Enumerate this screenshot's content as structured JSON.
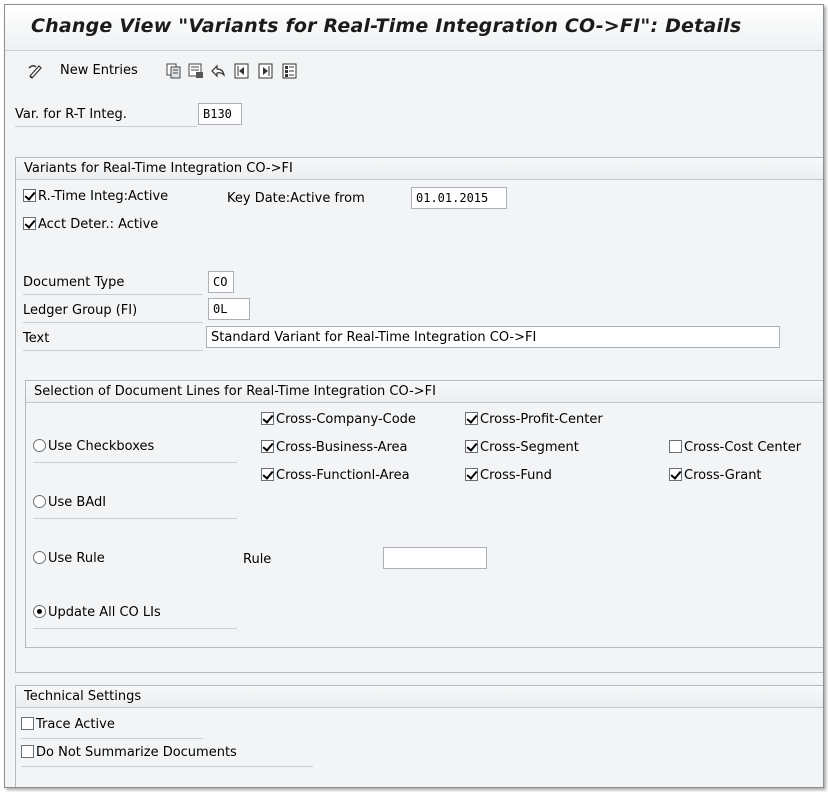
{
  "window": {
    "title": "Change View \"Variants for Real-Time Integration CO->FI\": Details"
  },
  "toolbar": {
    "new_entries_label": "New Entries",
    "icons": [
      "display-change-icon",
      "copy-icon",
      "delete-icon",
      "undo-icon",
      "previous-entry-icon",
      "next-entry-icon",
      "select-all-icon"
    ]
  },
  "variant": {
    "label": "Var. for R-T Integ.",
    "value": "B130"
  },
  "variants_group": {
    "title": "Variants for Real-Time Integration CO->FI",
    "rt_active_label": "R.-Time Integ:Active",
    "rt_active_checked": true,
    "key_date_label": "Key Date:Active from",
    "key_date_value": "01.01.2015",
    "acct_deter_label": "Acct Deter.: Active",
    "acct_deter_checked": true,
    "doc_type_label": "Document Type",
    "doc_type_value": "CO",
    "ledger_group_label": "Ledger Group (FI)",
    "ledger_group_value": "0L",
    "text_label": "Text",
    "text_value": "Standard Variant for Real-Time Integration CO->FI"
  },
  "selection_group": {
    "title": "Selection of Document Lines for Real-Time Integration CO->FI",
    "use_checkboxes_label": "Use Checkboxes",
    "use_badi_label": "Use BAdI",
    "use_rule_label": "Use Rule",
    "rule_label": "Rule",
    "rule_value": "",
    "update_all_label": "Update All CO LIs",
    "selected_option": "Update All CO LIs",
    "checkboxes": {
      "cross_company_code": {
        "label": "Cross-Company-Code",
        "checked": true
      },
      "cross_profit_center": {
        "label": "Cross-Profit-Center",
        "checked": true
      },
      "cross_business_area": {
        "label": "Cross-Business-Area",
        "checked": true
      },
      "cross_segment": {
        "label": "Cross-Segment",
        "checked": true
      },
      "cross_cost_center": {
        "label": "Cross-Cost Center",
        "checked": false
      },
      "cross_functional_area": {
        "label": "Cross-Functionl-Area",
        "checked": true
      },
      "cross_fund": {
        "label": "Cross-Fund",
        "checked": true
      },
      "cross_grant": {
        "label": "Cross-Grant",
        "checked": true
      }
    }
  },
  "technical_group": {
    "title": "Technical Settings",
    "trace_active_label": "Trace Active",
    "trace_active_checked": false,
    "no_summarize_label": "Do Not Summarize Documents",
    "no_summarize_checked": false
  }
}
